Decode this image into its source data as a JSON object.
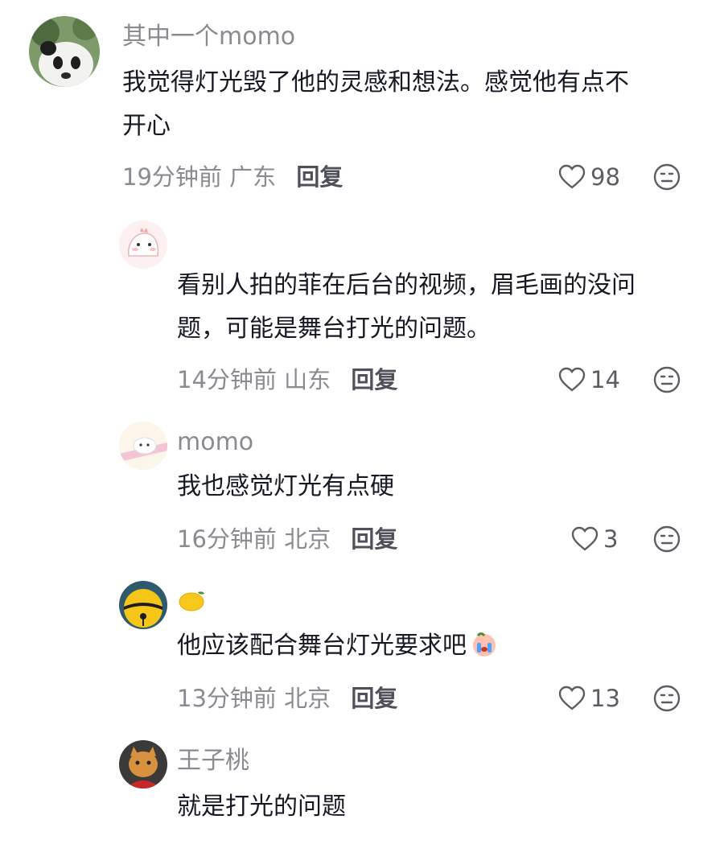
{
  "comments": [
    {
      "username": "其中一个momo",
      "text_line1": "我觉得灯光毁了他的灵感和想法。感觉他有点不",
      "text_line2": "开心",
      "time": "19分钟前",
      "location": "广东",
      "reply_label": "回复",
      "likes": "98"
    },
    {
      "username": "",
      "text_line1": "看别人拍的菲在后台的视频，眉毛画的没问",
      "text_line2": "题，可能是舞台打光的问题。",
      "time": "14分钟前",
      "location": "山东",
      "reply_label": "回复",
      "likes": "14"
    },
    {
      "username": "momo",
      "text_line1": "我也感觉灯光有点硬",
      "time": "16分钟前",
      "location": "北京",
      "reply_label": "回复",
      "likes": "3"
    },
    {
      "username": "🍋",
      "text_line1": "他应该配合舞台灯光要求吧",
      "time": "13分钟前",
      "location": "北京",
      "reply_label": "回复",
      "likes": "13"
    },
    {
      "username": "王子桃",
      "text_line1": "就是打光的问题"
    }
  ],
  "icons": {
    "like": "heart-outline-icon",
    "dislike": "meh-face-icon",
    "inline_emoji": "crying-peach-emoji"
  },
  "colors": {
    "text": "#161823",
    "secondary": "#8a8b91",
    "reply": "#4f5059"
  }
}
